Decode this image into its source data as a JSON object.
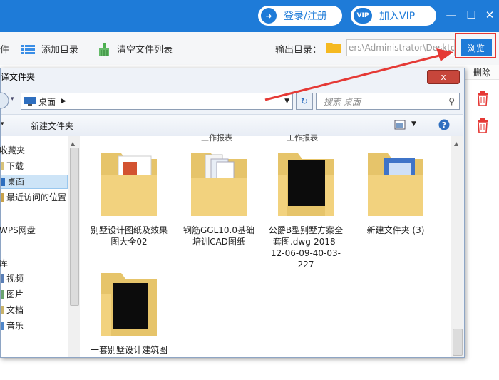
{
  "header": {
    "login_label": "登录/注册",
    "vip_badge": "VIP",
    "vip_label": "加入VIP",
    "minimize": "—",
    "maximize": "☐",
    "close": "✕"
  },
  "toolbar": {
    "file_partial": "件",
    "add_dir_label": "添加目录",
    "clear_list_label": "清空文件列表",
    "output_dir_label": "输出目录：",
    "output_dir_value": "ers\\Administrator\\Deskto",
    "browse_label": "浏览",
    "delete_label": "删除"
  },
  "dialog": {
    "title": "译文件夹",
    "close_label": "x",
    "address": "桌面",
    "search_placeholder": "搜索 桌面",
    "new_folder_label": "新建文件夹",
    "nav_items": [
      {
        "label": "收藏夹"
      },
      {
        "label": "下载"
      },
      {
        "label": "桌面"
      },
      {
        "label": "最近访问的位置"
      },
      {
        "label": "WPS网盘"
      },
      {
        "label": "库"
      },
      {
        "label": "视频"
      },
      {
        "label": "图片"
      },
      {
        "label": "文档"
      },
      {
        "label": "音乐"
      }
    ],
    "clipped_labels": [
      "工作报表",
      "工作报表"
    ],
    "folders": [
      {
        "label": "别墅设计图纸及效果图大全02"
      },
      {
        "label": "钢筋GGL10.0基础培训CAD图纸"
      },
      {
        "label": "公爵B型别墅方案全套图.dwg-2018-12-06-09-40-03-227"
      },
      {
        "label": "新建文件夹 (3)"
      },
      {
        "label": "一套别墅设计建筑图"
      }
    ]
  },
  "colors": {
    "brand_blue": "#1e7bd8",
    "highlight_red": "#e53935"
  }
}
